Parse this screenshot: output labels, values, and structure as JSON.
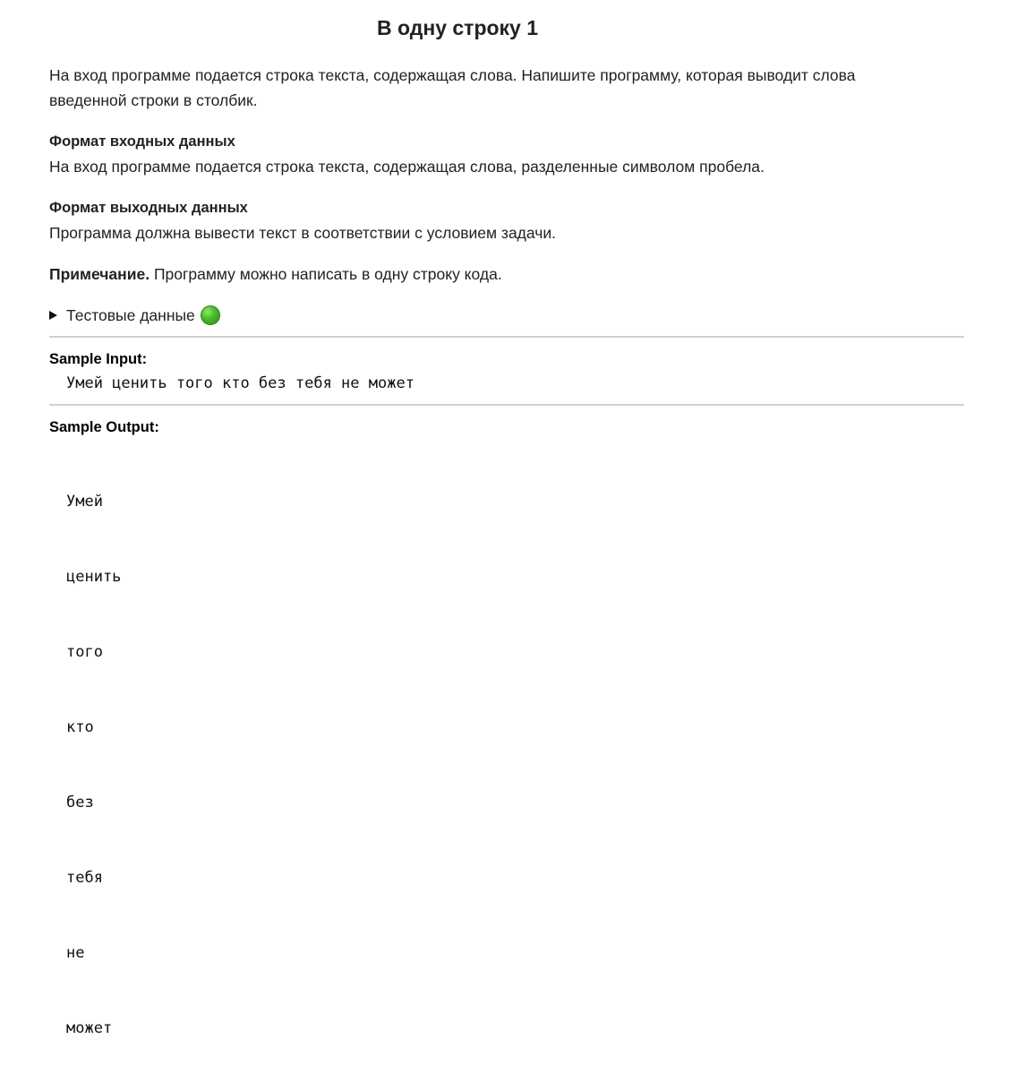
{
  "title": "В одну строку 1",
  "description": "На вход программе подается строка текста, содержащая слова. Напишите программу, которая выводит слова введенной строки в столбик.",
  "input_format": {
    "heading": "Формат входных данных",
    "text": "На вход программе подается строка текста, содержащая слова, разделенные символом пробела."
  },
  "output_format": {
    "heading": "Формат выходных данных",
    "text": "Программа должна вывести текст в соответствии с условием задачи."
  },
  "note": {
    "label": "Примечание.",
    "text": " Программу можно написать в одну строку кода."
  },
  "test_data": {
    "label": "Тестовые данные",
    "status_icon": "green-circle-icon",
    "status_color": "#46b827"
  },
  "sample_input": {
    "label": "Sample Input:",
    "value": "Умей ценить того кто без тебя не может"
  },
  "sample_output": {
    "label": "Sample Output:",
    "lines": [
      "Умей",
      "ценить",
      "того",
      "кто",
      "без",
      "тебя",
      "не",
      "может"
    ]
  }
}
